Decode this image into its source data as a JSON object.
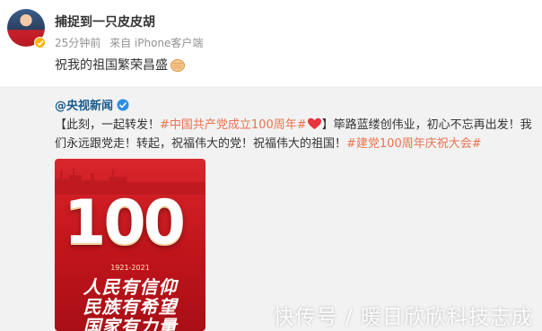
{
  "post": {
    "username": "捕捉到一只皮皮胡",
    "time": "25分钟前",
    "source": "来自 iPhone客户端",
    "content": "祝我的祖国繁荣昌盛",
    "content_emoji": "fist-icon"
  },
  "retweet": {
    "author": "@央视新闻",
    "segments": [
      {
        "text": "【此刻，一起转发！",
        "tag": false
      },
      {
        "text": "#中国共产党成立100周年#",
        "tag": true
      },
      {
        "text": "】筚路蓝缕创伟业，初心不忘再出发！我们永远跟党走！转起，祝福伟大的党！祝福伟大的祖国！",
        "tag": false
      },
      {
        "text": "#建党100周年庆祝大会#",
        "tag": true
      }
    ],
    "poster": {
      "number": "100",
      "years": "1921-2021",
      "slogans": [
        "人民有信仰",
        "民族有希望",
        "国家有力量"
      ]
    }
  },
  "watermark": "快传号 / 暖日欣欣科技志成",
  "colors": {
    "tag": "#eb7350",
    "author": "#1a5a8a",
    "retweet_bg": "#f2f2f2",
    "poster_red": "#c0141b"
  }
}
